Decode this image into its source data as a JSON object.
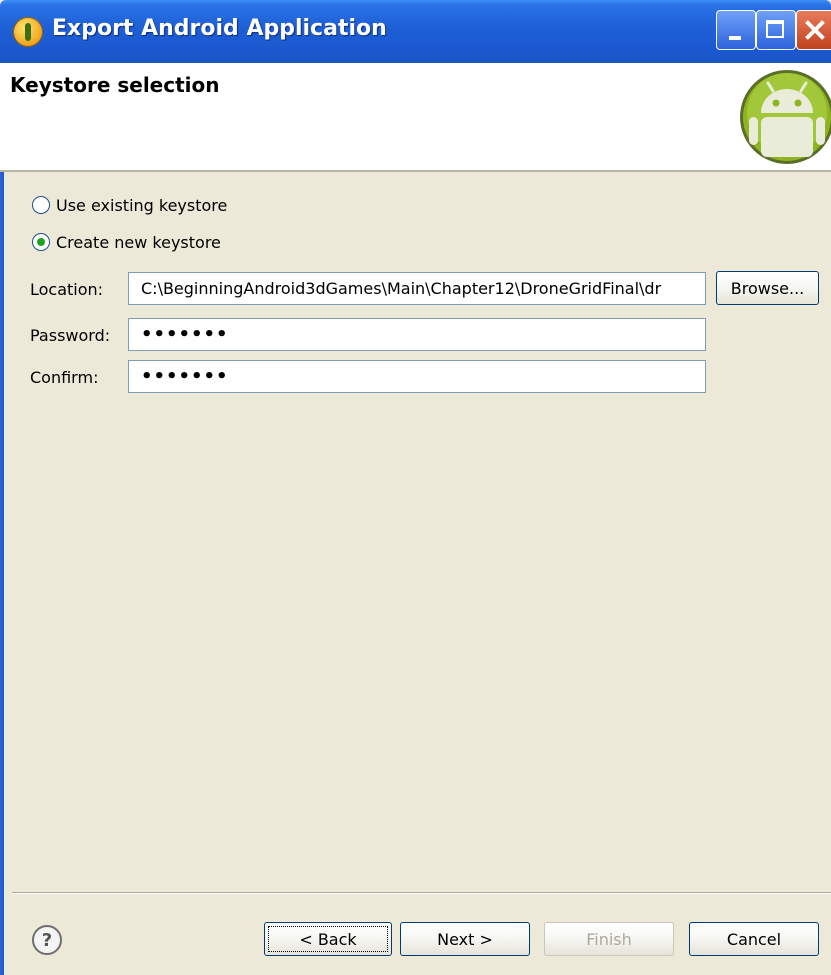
{
  "window": {
    "title": "Export Android Application"
  },
  "header": {
    "title": "Keystore selection"
  },
  "keystore_options": [
    {
      "label": "Use existing keystore",
      "selected": false
    },
    {
      "label": "Create new keystore",
      "selected": true
    }
  ],
  "fields": {
    "location": {
      "label": "Location:",
      "value": "C:\\BeginningAndroid3dGames\\Main\\Chapter12\\DroneGridFinal\\dr"
    },
    "password": {
      "label": "Password:",
      "value": "•••••••"
    },
    "confirm": {
      "label": "Confirm:",
      "value": "•••••••"
    }
  },
  "buttons": {
    "browse": "Browse...",
    "back": "< Back",
    "next": "Next >",
    "finish": "Finish",
    "cancel": "Cancel"
  },
  "icons": {
    "help": "?"
  },
  "colors": {
    "titlebar": "#1e5fd6",
    "dialog_bg": "#ece9d8",
    "header_bg": "#ffffff",
    "android_green": "#97c024"
  }
}
